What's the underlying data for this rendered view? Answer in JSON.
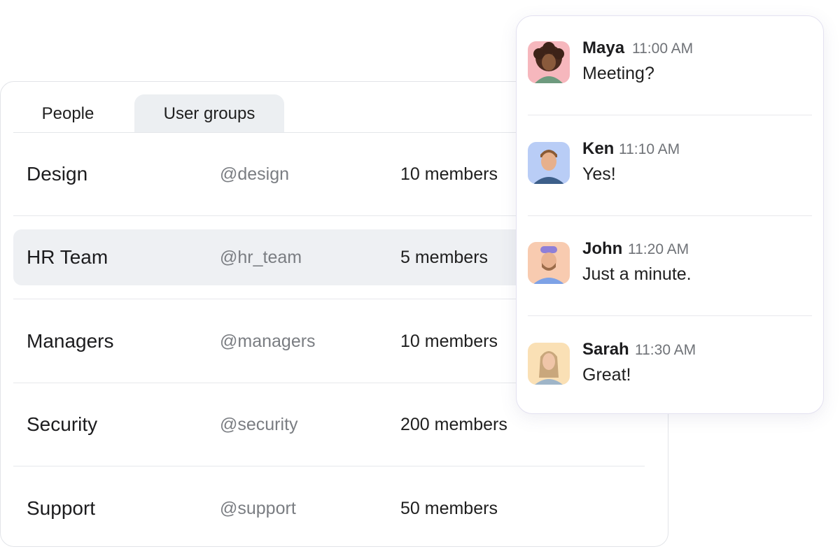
{
  "tabs": [
    {
      "label": "People",
      "active": false
    },
    {
      "label": "User groups",
      "active": true
    }
  ],
  "groups": [
    {
      "name": "Design",
      "handle": "@design",
      "members": "10 members",
      "selected": false
    },
    {
      "name": "HR Team",
      "handle": "@hr_team",
      "members": "5 members",
      "selected": true
    },
    {
      "name": "Managers",
      "handle": "@managers",
      "members": "10 members",
      "selected": false
    },
    {
      "name": "Security",
      "handle": "@security",
      "members": "200 members",
      "selected": false
    },
    {
      "name": "Support",
      "handle": "@support",
      "members": "50 members",
      "selected": false
    }
  ],
  "messages": [
    {
      "sender": "Maya",
      "time": "11:00 AM",
      "text": "Meeting?",
      "avatar": "avatar-maya",
      "avatar_bg": "#f6b7bd"
    },
    {
      "sender": "Ken",
      "time": "11:10 AM",
      "text": "Yes!",
      "avatar": "avatar-ken",
      "avatar_bg": "#b9cdf6"
    },
    {
      "sender": "John",
      "time": "11:20 AM",
      "text": "Just a minute.",
      "avatar": "avatar-john",
      "avatar_bg": "#f8cbb0"
    },
    {
      "sender": "Sarah",
      "time": "11:30 AM",
      "text": "Great!",
      "avatar": "avatar-sarah",
      "avatar_bg": "#fae0b5"
    }
  ],
  "colors": {
    "selected_row_bg": "#eef0f3",
    "active_tab_bg": "#eceff2",
    "muted_text": "#7a7d82"
  }
}
